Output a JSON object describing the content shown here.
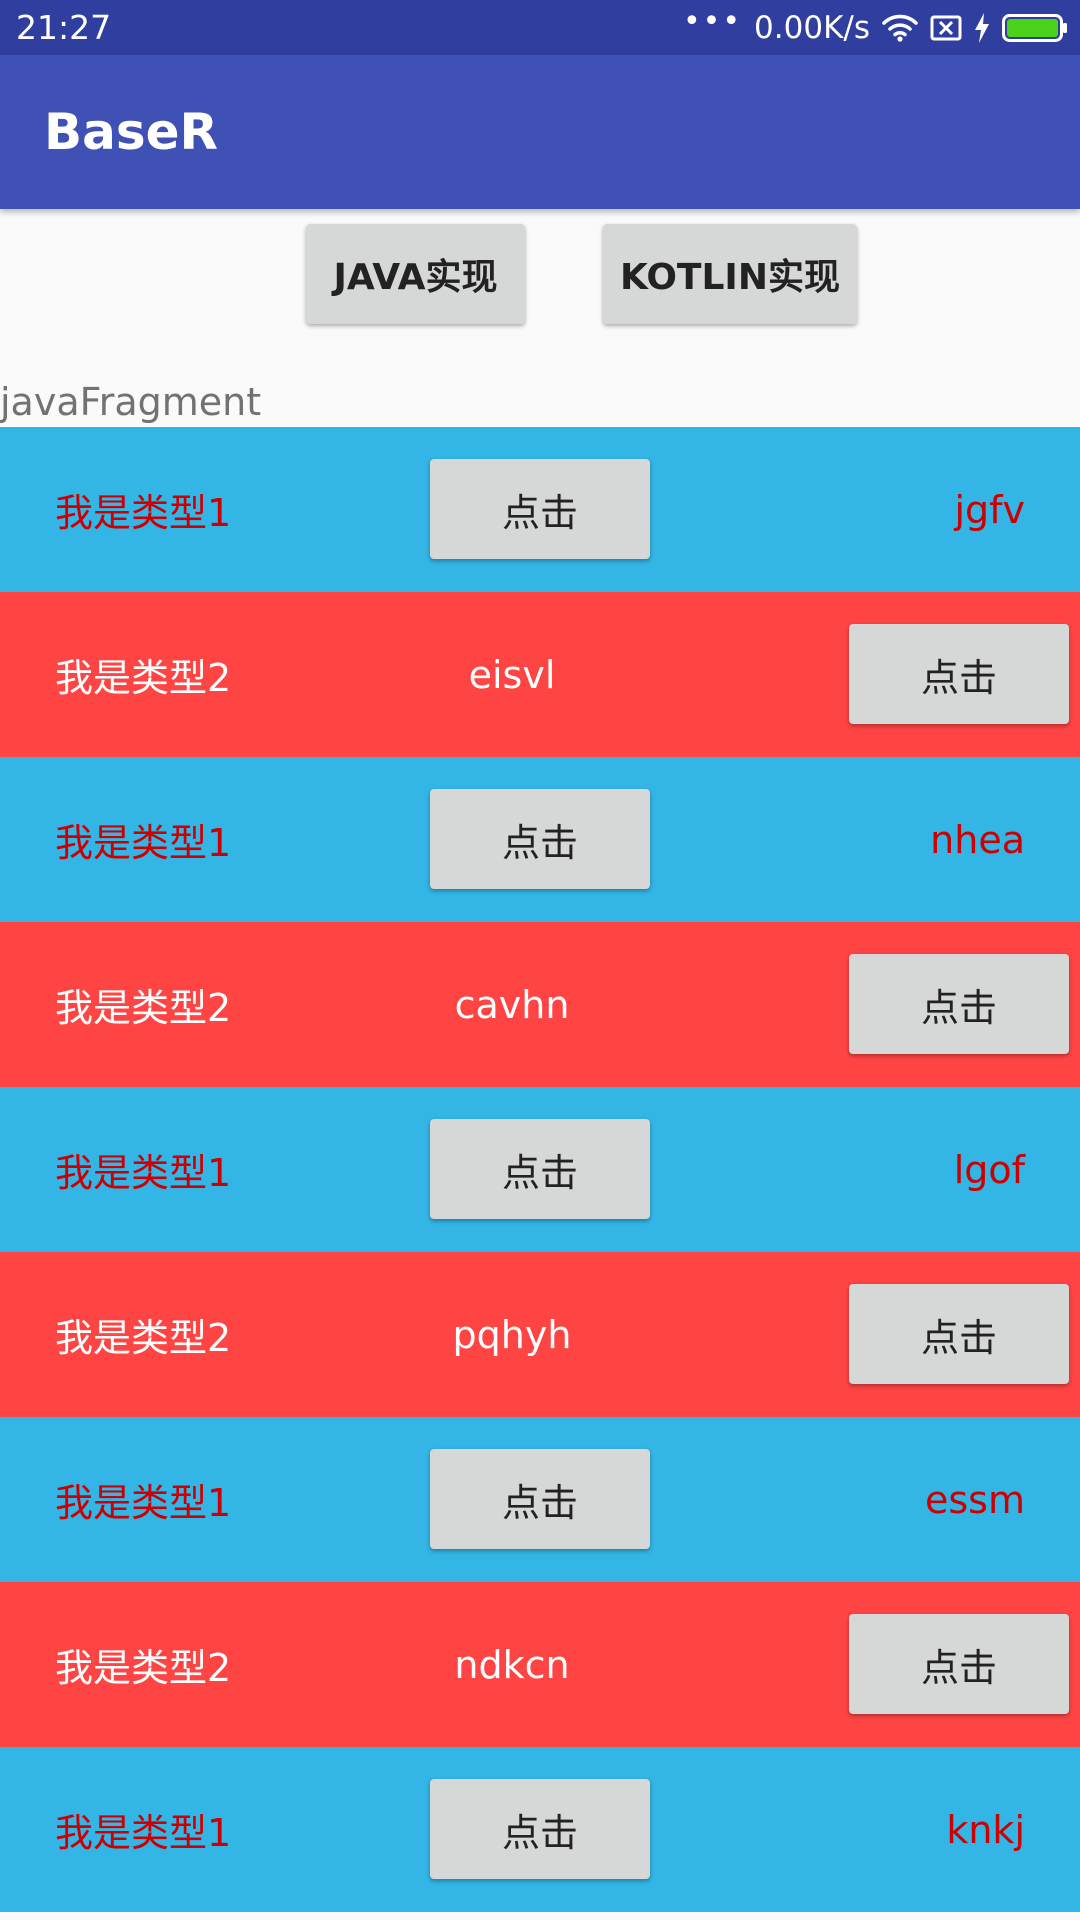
{
  "status_bar": {
    "time": "21:27",
    "dots": "•••",
    "network_speed": "0.00K/s",
    "icons": [
      "wifi-icon",
      "no-sim-icon",
      "charging-icon",
      "battery-icon"
    ],
    "battery_color": "#4cd21a"
  },
  "app_bar": {
    "title": "BaseR",
    "color": "#3f51b5"
  },
  "buttons": {
    "java": "JAVA实现",
    "kotlin": "KOTLIN实现"
  },
  "fragment_label": "javaFragment",
  "colors": {
    "type1_background": "#33b5e5",
    "type2_background": "#ff4444",
    "type1_text": "#cc0000",
    "type2_text": "#ffffff"
  },
  "list": {
    "items": [
      {
        "type": 1,
        "label": "我是类型1",
        "button": "点击",
        "text": "jgfv"
      },
      {
        "type": 2,
        "label": "我是类型2",
        "button": "点击",
        "text": "eisvl"
      },
      {
        "type": 1,
        "label": "我是类型1",
        "button": "点击",
        "text": "nhea"
      },
      {
        "type": 2,
        "label": "我是类型2",
        "button": "点击",
        "text": "cavhn"
      },
      {
        "type": 1,
        "label": "我是类型1",
        "button": "点击",
        "text": "lgof"
      },
      {
        "type": 2,
        "label": "我是类型2",
        "button": "点击",
        "text": "pqhyh"
      },
      {
        "type": 1,
        "label": "我是类型1",
        "button": "点击",
        "text": "essm"
      },
      {
        "type": 2,
        "label": "我是类型2",
        "button": "点击",
        "text": "ndkcn"
      },
      {
        "type": 1,
        "label": "我是类型1",
        "button": "点击",
        "text": "knkj"
      }
    ]
  }
}
